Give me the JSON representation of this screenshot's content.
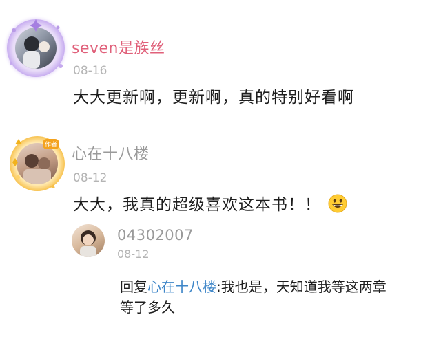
{
  "comments": [
    {
      "username": "seven是族丝",
      "username_color": "#e0607a",
      "date": "08-16",
      "text": "大大更新啊，更新啊，真的特别好看啊"
    },
    {
      "username": "心在十八楼",
      "username_color": "#9a9a9a",
      "date": "08-12",
      "text": "大大，我真的超级喜欢这本书！！",
      "emoji": "grinning-face-emoji",
      "badge": "作者"
    }
  ],
  "reply": {
    "username": "04302007",
    "date": "08-12",
    "prefix": "回复",
    "mention": "心在十八楼",
    "separator": ":",
    "text_line1": "我也是，天知道我等这两章",
    "text_line2": "等了多久"
  },
  "colors": {
    "mention": "#3e86c8",
    "date": "#b4b4b4",
    "text": "#1e1e1e"
  }
}
